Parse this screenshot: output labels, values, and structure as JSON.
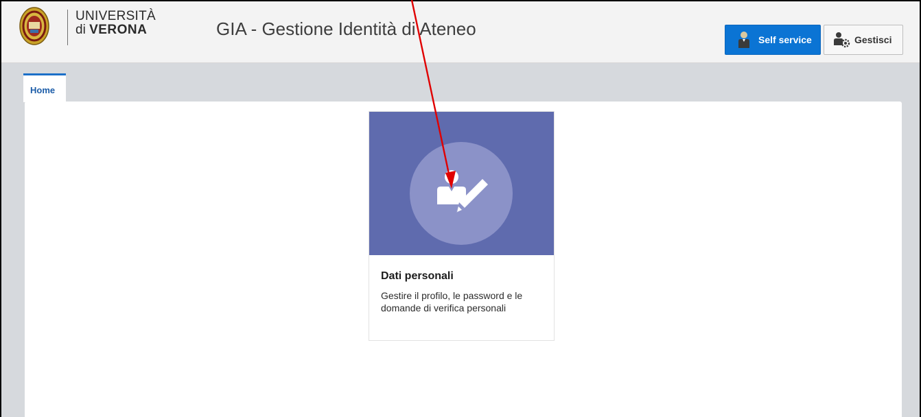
{
  "header": {
    "logo_line1": "UNIVERSITÀ",
    "logo_line2_prefix": "di ",
    "logo_line2_bold": "VERONA",
    "app_title": "GIA - Gestione Identità di Ateneo",
    "buttons": {
      "self_service": {
        "label": "Self service",
        "icon": "user-icon"
      },
      "manage": {
        "label": "Gestisci",
        "icon": "user-gear-icon"
      }
    }
  },
  "tabs": [
    {
      "label": "Home",
      "active": true
    }
  ],
  "card": {
    "title": "Dati personali",
    "description": "Gestire il profilo, le password e le domande di verifica personali",
    "icon": "user-edit-icon"
  },
  "colors": {
    "primary_button": "#0b74d4",
    "card_banner": "#5f6bae",
    "card_circle": "#8b92c8",
    "tab_accent": "#1b6fc8",
    "annotation_arrow": "#e00000"
  }
}
